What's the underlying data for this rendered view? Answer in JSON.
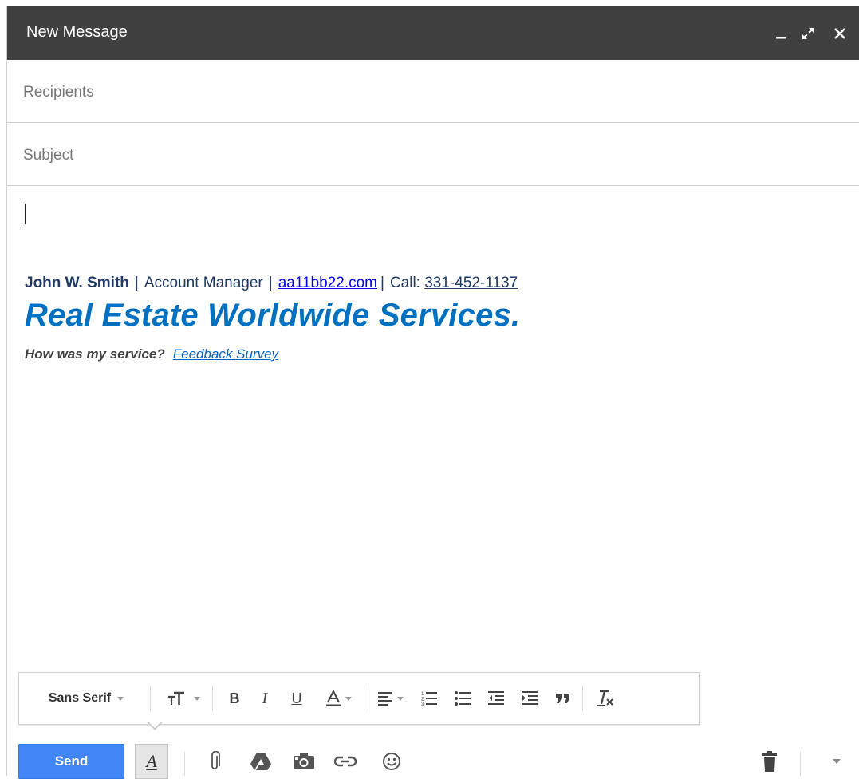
{
  "window": {
    "title": "New Message"
  },
  "fields": {
    "recipients_placeholder": "Recipients",
    "subject_placeholder": "Subject"
  },
  "signature": {
    "name": "John W. Smith",
    "separator": "|",
    "role": "Account Manager",
    "website": "aa11bb22.com",
    "call_label": "Call:",
    "phone": "331-452-1137",
    "company": "Real Estate Worldwide Services.",
    "feedback_question": "How was my service?",
    "feedback_link": "Feedback Survey"
  },
  "formatting": {
    "font": "Sans Serif",
    "tools": [
      "font-family",
      "text-size",
      "bold",
      "italic",
      "underline",
      "text-color",
      "align",
      "numbered-list",
      "bulleted-list",
      "indent-less",
      "indent-more",
      "quote",
      "remove-formatting"
    ]
  },
  "bottom_toolbar": {
    "send_label": "Send",
    "icons": [
      "formatting-options-icon",
      "attach-icon",
      "drive-icon",
      "photo-icon",
      "link-icon",
      "emoji-icon",
      "trash-icon",
      "more-options-icon"
    ]
  },
  "colors": {
    "titlebar": "#404040",
    "send_button": "#4285f4",
    "company_blue": "#0070c0",
    "signature_navy": "#1f3864",
    "link_blue": "#0000ee"
  }
}
